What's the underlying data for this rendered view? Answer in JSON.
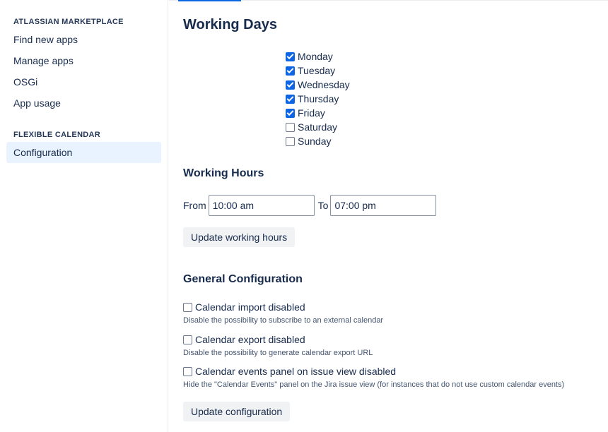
{
  "sidebar": {
    "sections": [
      {
        "title": "ATLASSIAN MARKETPLACE",
        "items": [
          {
            "label": "Find new apps"
          },
          {
            "label": "Manage apps"
          },
          {
            "label": "OSGi"
          },
          {
            "label": "App usage"
          }
        ]
      },
      {
        "title": "FLEXIBLE CALENDAR",
        "items": [
          {
            "label": "Configuration",
            "active": true
          }
        ]
      }
    ]
  },
  "main": {
    "title": "Working Days",
    "working_days": [
      {
        "label": "Monday",
        "checked": true
      },
      {
        "label": "Tuesday",
        "checked": true
      },
      {
        "label": "Wednesday",
        "checked": true
      },
      {
        "label": "Thursday",
        "checked": true
      },
      {
        "label": "Friday",
        "checked": true
      },
      {
        "label": "Saturday",
        "checked": false
      },
      {
        "label": "Sunday",
        "checked": false
      }
    ],
    "working_hours": {
      "title": "Working Hours",
      "from_label": "From",
      "from_value": "10:00 am",
      "to_label": "To",
      "to_value": "07:00 pm",
      "update_button": "Update working hours"
    },
    "general": {
      "title": "General Configuration",
      "options": [
        {
          "label": "Calendar import disabled",
          "description": "Disable the possibility to subscribe to an external calendar",
          "checked": false
        },
        {
          "label": "Calendar export disabled",
          "description": "Disable the possibility to generate calendar export URL",
          "checked": false
        },
        {
          "label": "Calendar events panel on issue view disabled",
          "description": "Hide the \"Calendar Events\" panel on the Jira issue view (for instances that do not use custom calendar events)",
          "checked": false
        }
      ],
      "update_button": "Update configuration"
    }
  },
  "colors": {
    "accent": "#0c66e4",
    "active_item_bg": "#e9f2ff",
    "text": "#172b4d"
  }
}
